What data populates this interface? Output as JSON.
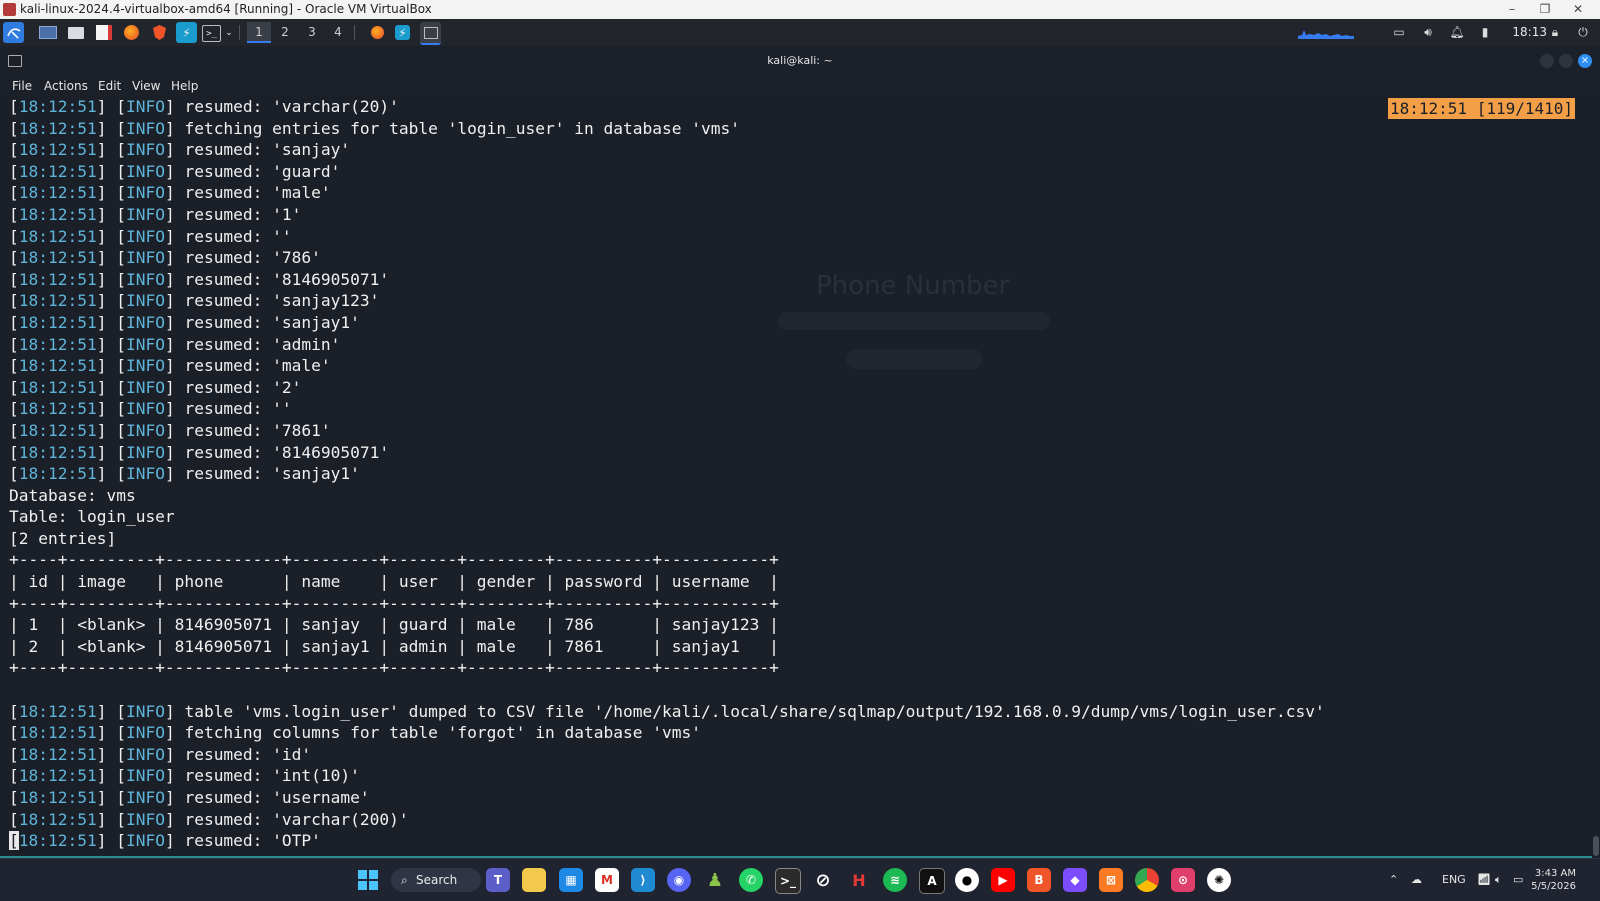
{
  "vbox": {
    "title": "kali-linux-2024.4-virtualbox-amd64 [Running] - Oracle VM VirtualBox",
    "minimize": "–",
    "restore": "❐",
    "close": "✕"
  },
  "panel": {
    "workspaces": [
      "1",
      "2",
      "3",
      "4"
    ],
    "active_workspace": "1",
    "clock": "18:13"
  },
  "terminal_window": {
    "title": "kali@kali: ~",
    "close_glyph": "×"
  },
  "menu": {
    "file": "File",
    "actions": "Actions",
    "edit": "Edit",
    "view": "View",
    "help": "Help"
  },
  "terminal": {
    "search_badge": "18:12:51 [119/1410]",
    "lines_top": [
      {
        "ts": "18:12:51",
        "lvl": "INFO",
        "msg": "resumed: 'varchar(20)'"
      },
      {
        "ts": "18:12:51",
        "lvl": "INFO",
        "msg": "fetching entries for table 'login_user' in database 'vms'"
      },
      {
        "ts": "18:12:51",
        "lvl": "INFO",
        "msg": "resumed: 'sanjay'"
      },
      {
        "ts": "18:12:51",
        "lvl": "INFO",
        "msg": "resumed: 'guard'"
      },
      {
        "ts": "18:12:51",
        "lvl": "INFO",
        "msg": "resumed: 'male'"
      },
      {
        "ts": "18:12:51",
        "lvl": "INFO",
        "msg": "resumed: '1'"
      },
      {
        "ts": "18:12:51",
        "lvl": "INFO",
        "msg": "resumed: ''"
      },
      {
        "ts": "18:12:51",
        "lvl": "INFO",
        "msg": "resumed: '786'"
      },
      {
        "ts": "18:12:51",
        "lvl": "INFO",
        "msg": "resumed: '8146905071'"
      },
      {
        "ts": "18:12:51",
        "lvl": "INFO",
        "msg": "resumed: 'sanjay123'"
      },
      {
        "ts": "18:12:51",
        "lvl": "INFO",
        "msg": "resumed: 'sanjay1'"
      },
      {
        "ts": "18:12:51",
        "lvl": "INFO",
        "msg": "resumed: 'admin'"
      },
      {
        "ts": "18:12:51",
        "lvl": "INFO",
        "msg": "resumed: 'male'"
      },
      {
        "ts": "18:12:51",
        "lvl": "INFO",
        "msg": "resumed: '2'"
      },
      {
        "ts": "18:12:51",
        "lvl": "INFO",
        "msg": "resumed: ''"
      },
      {
        "ts": "18:12:51",
        "lvl": "INFO",
        "msg": "resumed: '7861'"
      },
      {
        "ts": "18:12:51",
        "lvl": "INFO",
        "msg": "resumed: '8146905071'"
      },
      {
        "ts": "18:12:51",
        "lvl": "INFO",
        "msg": "resumed: 'sanjay1'"
      }
    ],
    "db_line": "Database: vms",
    "table_line": "Table: login_user",
    "entries_line": "[2 entries]",
    "table_border": "+----+---------+------------+---------+-------+--------+----------+-----------+",
    "table_header": "| id | image   | phone      | name    | user  | gender | password | username  |",
    "table_rows": [
      "| 1  | <blank> | 8146905071 | sanjay  | guard | male   | 786      | sanjay123 |",
      "| 2  | <blank> | 8146905071 | sanjay1 | admin | male   | 7861     | sanjay1   |"
    ],
    "lines_bottom": [
      {
        "ts": "18:12:51",
        "lvl": "INFO",
        "msg": "table 'vms.login_user' dumped to CSV file '/home/kali/.local/share/sqlmap/output/192.168.0.9/dump/vms/login_user.csv'"
      },
      {
        "ts": "18:12:51",
        "lvl": "INFO",
        "msg": "fetching columns for table 'forgot' in database 'vms'"
      },
      {
        "ts": "18:12:51",
        "lvl": "INFO",
        "msg": "resumed: 'id'"
      },
      {
        "ts": "18:12:51",
        "lvl": "INFO",
        "msg": "resumed: 'int(10)'"
      },
      {
        "ts": "18:12:51",
        "lvl": "INFO",
        "msg": "resumed: 'username'"
      },
      {
        "ts": "18:12:51",
        "lvl": "INFO",
        "msg": "resumed: 'varchar(200)'"
      }
    ],
    "last_line": {
      "cursor_char": "[",
      "ts": "18:12:51",
      "lvl": "INFO",
      "msg": "resumed: 'OTP'"
    },
    "ghost_phone_label": "Phone Number"
  },
  "taskbar": {
    "search_label": "Search",
    "language": "ENG",
    "time": "3:43 AM",
    "date": "5/5/2026"
  }
}
